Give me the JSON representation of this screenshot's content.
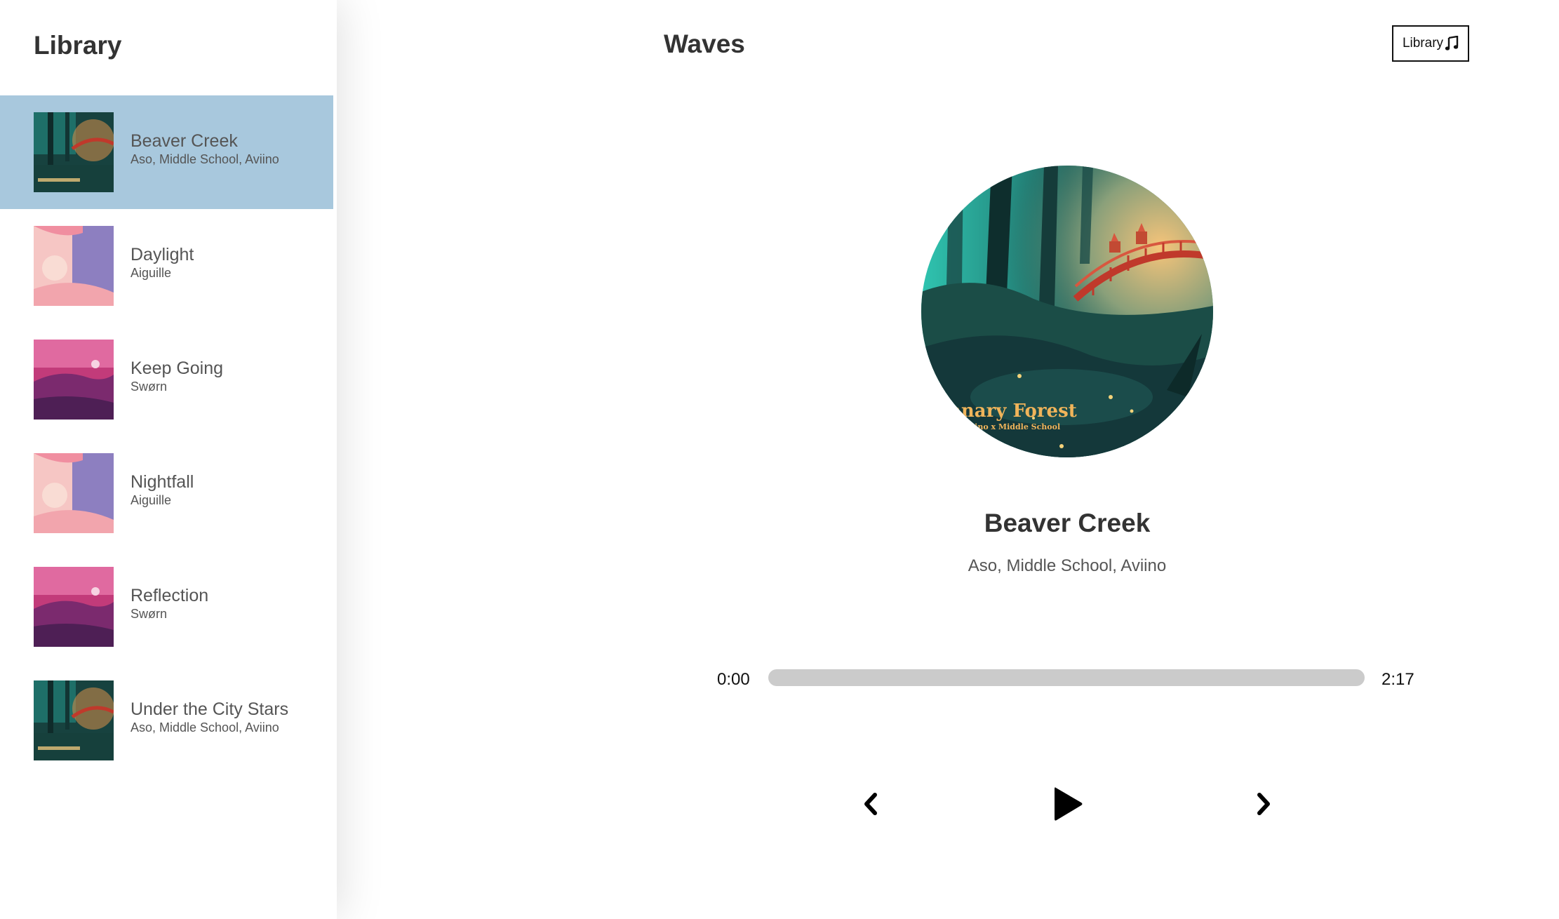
{
  "sidebar": {
    "title": "Library",
    "songs": [
      {
        "name": "Beaver Creek",
        "artist": "Aso, Middle School, Aviino",
        "cover": "canary-forest-cover",
        "selected": true
      },
      {
        "name": "Daylight",
        "artist": "Aiguille",
        "cover": "pink-sky-cover",
        "selected": false
      },
      {
        "name": "Keep Going",
        "artist": "Swørn",
        "cover": "magenta-landscape-cover",
        "selected": false
      },
      {
        "name": "Nightfall",
        "artist": "Aiguille",
        "cover": "pink-sky-cover",
        "selected": false
      },
      {
        "name": "Reflection",
        "artist": "Swørn",
        "cover": "magenta-landscape-cover",
        "selected": false
      },
      {
        "name": "Under the City Stars",
        "artist": "Aso, Middle School, Aviino",
        "cover": "canary-forest-cover",
        "selected": false
      }
    ]
  },
  "header": {
    "title": "Waves",
    "library_button_label": "Library",
    "library_button_icon": "music-note-icon"
  },
  "player": {
    "track_title": "Beaver Creek",
    "track_artist": "Aso, Middle School, Aviino",
    "art_text_line1": "anary Forest",
    "art_text_line2": "iino x Middle School",
    "current_time": "0:00",
    "total_time": "2:17",
    "progress": 0,
    "controls": {
      "prev_icon": "chevron-left-icon",
      "play_icon": "play-icon",
      "next_icon": "chevron-right-icon"
    }
  },
  "colors": {
    "selected_row": "#a8c8dd",
    "progress_track": "#cbcbcb",
    "text_primary": "#333333",
    "text_secondary": "#555555"
  }
}
